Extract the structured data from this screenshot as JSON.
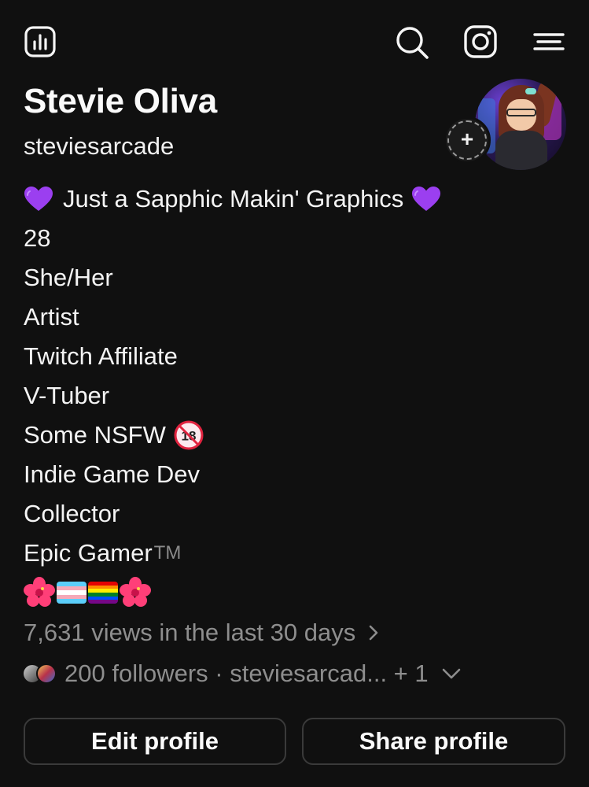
{
  "header": {
    "icons": [
      "insights-icon",
      "search-icon",
      "instagram-icon",
      "menu-icon"
    ]
  },
  "profile": {
    "display_name": "Stevie Oliva",
    "username": "steviesarcade",
    "story_add_symbol": "+"
  },
  "bio": {
    "headline": "Just a Sapphic Makin' Graphics",
    "headline_emoji": "purple-heart",
    "lines": [
      "28",
      "She/Her",
      "Artist",
      "Twitch Affiliate",
      "V-Tuber"
    ],
    "nsfw_label": "Some NSFW",
    "nsfw_emoji": "no-one-under-eighteen",
    "lines_after": [
      "Indie Game Dev",
      "Collector"
    ],
    "gamer_label": "Epic Gamer",
    "trademark": "TM",
    "emoji_row": [
      "hibiscus",
      "transgender-flag",
      "rainbow-flag",
      "hibiscus"
    ]
  },
  "stats": {
    "views_text": "7,631 views in the last 30 days",
    "followers_text": "200 followers · steviesarcad... + 1"
  },
  "actions": {
    "edit_label": "Edit profile",
    "share_label": "Share profile"
  },
  "colors": {
    "background": "#101010",
    "text": "#f5f5f5",
    "muted": "#8e8e8e",
    "button_border": "#3a3a3a",
    "heart": "#9b3ff0"
  }
}
